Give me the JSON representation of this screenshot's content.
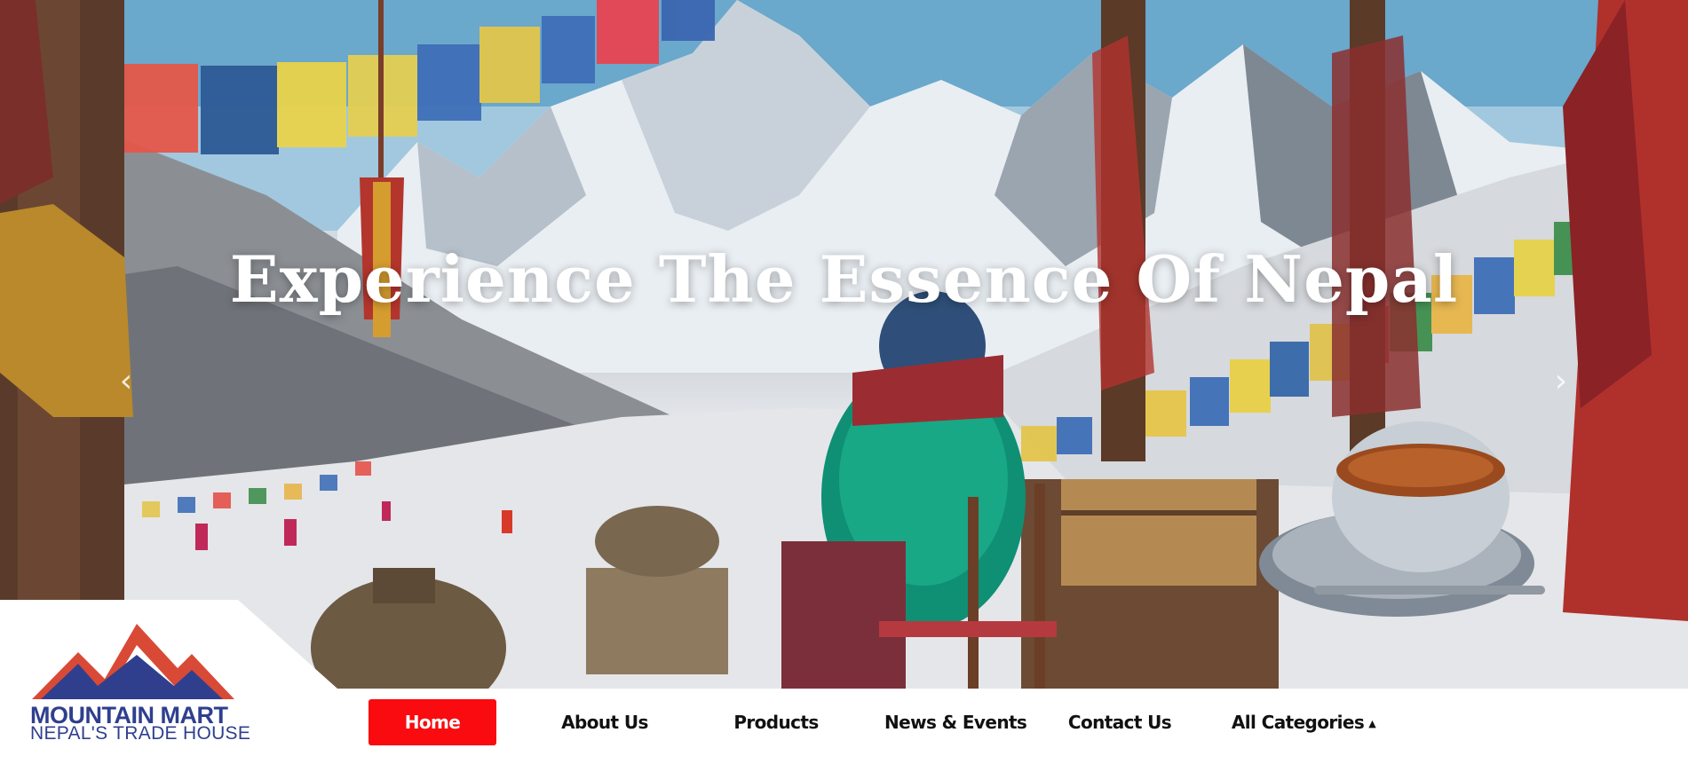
{
  "hero": {
    "title": "Experience The Essence Of Nepal",
    "prev_arrow": "‹",
    "next_arrow": "›"
  },
  "brand": {
    "name": "MOUNTAIN MART",
    "tagline": "NEPAL'S TRADE HOUSE",
    "logo_icon": "mountain-logo-icon",
    "colors": {
      "red": "#d94a36",
      "navy": "#2f3f8e"
    }
  },
  "nav": {
    "items": [
      {
        "label": "Home",
        "active": true
      },
      {
        "label": "About Us"
      },
      {
        "label": "Products"
      },
      {
        "label": "News & Events"
      },
      {
        "label": "Contact Us"
      },
      {
        "label": "All Categories",
        "icon": "caret-up-icon"
      }
    ],
    "active_color": "#f90b0f"
  }
}
